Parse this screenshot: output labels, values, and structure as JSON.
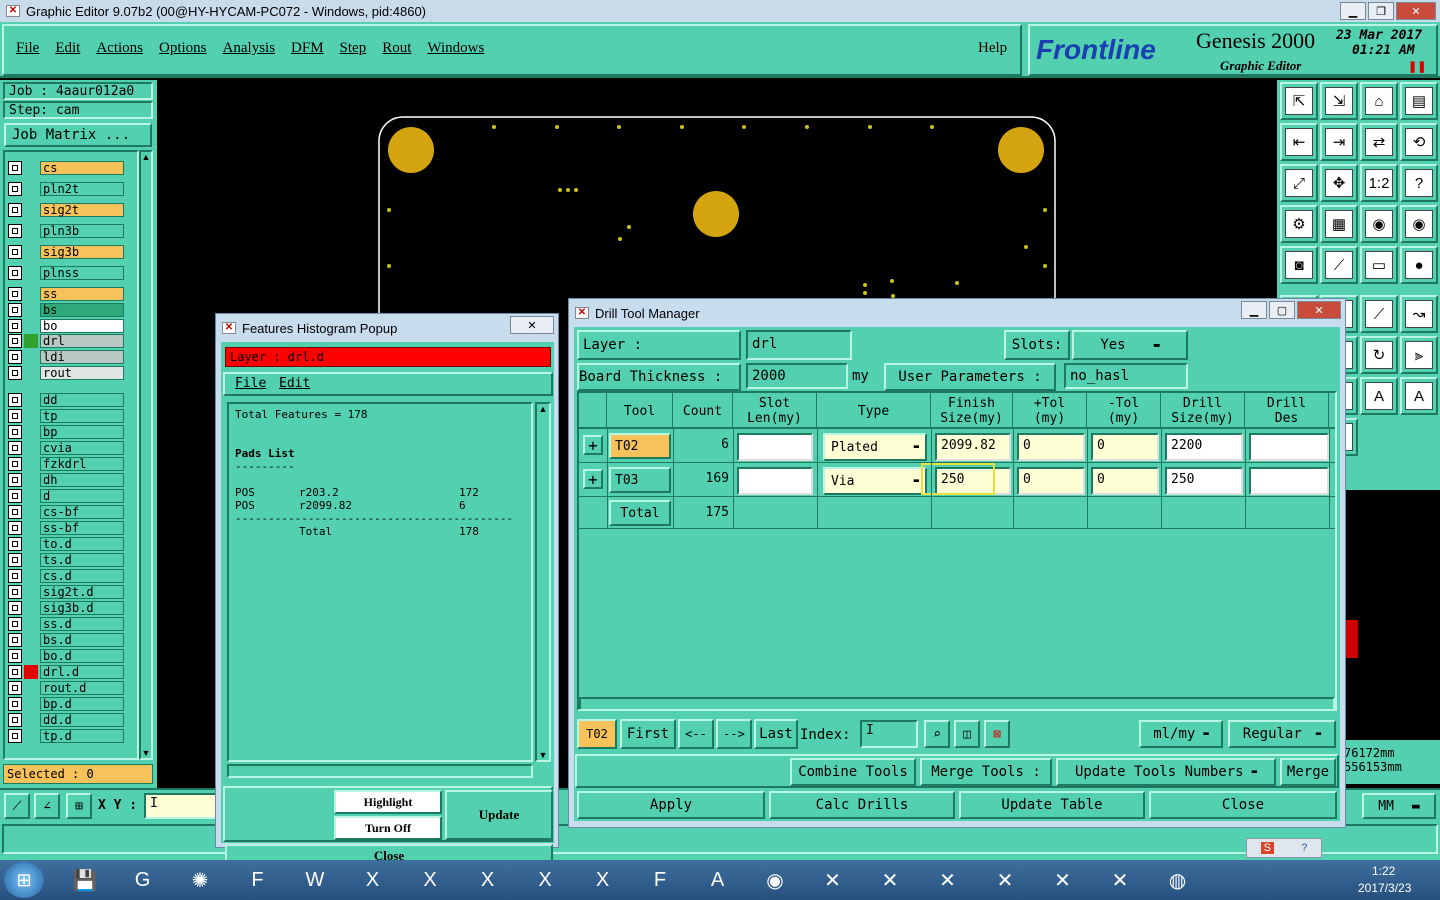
{
  "window": {
    "title": "Graphic Editor 9.07b2 (00@HY-HYCAM-PC072 - Windows, pid:4860)"
  },
  "menu": {
    "items": [
      "File",
      "Edit",
      "Actions",
      "Options",
      "Analysis",
      "DFM",
      "Step",
      "Rout",
      "Windows"
    ],
    "help": "Help"
  },
  "brand": {
    "logo": "Frontline",
    "product": "Genesis 2000",
    "subtitle": "Graphic Editor",
    "date": "23 Mar 2017",
    "time": "01:21 AM"
  },
  "job": {
    "job_label": "Job : 4aaur012a0",
    "step_label": "Step: cam",
    "matrix_button": "Job Matrix ..."
  },
  "layers": [
    {
      "name": "cs",
      "color": "#f7c25a",
      "mark": ""
    },
    {
      "name": "pln2t",
      "color": "#53d0af",
      "mark": ""
    },
    {
      "name": "sig2t",
      "color": "#f7c25a",
      "mark": ""
    },
    {
      "name": "pln3b",
      "color": "#53d0af",
      "mark": ""
    },
    {
      "name": "sig3b",
      "color": "#f7c25a",
      "mark": ""
    },
    {
      "name": "plnss",
      "color": "#53d0af",
      "mark": ""
    },
    {
      "name": "ss",
      "color": "#f7c25a",
      "mark": ""
    },
    {
      "name": "bs",
      "color": "#2eaa7a",
      "mark": ""
    },
    {
      "name": "bo",
      "color": "#ffffff",
      "mark": ""
    },
    {
      "name": "drl",
      "color": "#b9c9c2",
      "mark": "#30a030"
    },
    {
      "name": "ldi",
      "color": "#b9c9c2",
      "mark": ""
    },
    {
      "name": "rout",
      "color": "#dfe6e3",
      "mark": ""
    },
    {
      "name": "dd",
      "color": "#53d0af",
      "mark": ""
    },
    {
      "name": "tp",
      "color": "#53d0af",
      "mark": ""
    },
    {
      "name": "bp",
      "color": "#53d0af",
      "mark": ""
    },
    {
      "name": "cvia",
      "color": "#53d0af",
      "mark": ""
    },
    {
      "name": "fzkdrl",
      "color": "#53d0af",
      "mark": ""
    },
    {
      "name": "dh",
      "color": "#53d0af",
      "mark": ""
    },
    {
      "name": "d",
      "color": "#53d0af",
      "mark": ""
    },
    {
      "name": "cs-bf",
      "color": "#53d0af",
      "mark": ""
    },
    {
      "name": "ss-bf",
      "color": "#53d0af",
      "mark": ""
    },
    {
      "name": "to.d",
      "color": "#53d0af",
      "mark": ""
    },
    {
      "name": "ts.d",
      "color": "#53d0af",
      "mark": ""
    },
    {
      "name": "cs.d",
      "color": "#53d0af",
      "mark": ""
    },
    {
      "name": "sig2t.d",
      "color": "#53d0af",
      "mark": ""
    },
    {
      "name": "sig3b.d",
      "color": "#53d0af",
      "mark": ""
    },
    {
      "name": "ss.d",
      "color": "#53d0af",
      "mark": ""
    },
    {
      "name": "bs.d",
      "color": "#53d0af",
      "mark": ""
    },
    {
      "name": "bo.d",
      "color": "#53d0af",
      "mark": ""
    },
    {
      "name": "drl.d",
      "color": "#53d0af",
      "mark": "#e00000"
    },
    {
      "name": "rout.d",
      "color": "#53d0af",
      "mark": ""
    },
    {
      "name": "bp.d",
      "color": "#53d0af",
      "mark": ""
    },
    {
      "name": "dd.d",
      "color": "#53d0af",
      "mark": ""
    },
    {
      "name": "tp.d",
      "color": "#53d0af",
      "mark": ""
    }
  ],
  "selected": "Selected : 0",
  "xy_label": "X Y :",
  "histogram": {
    "title": "Features Histogram Popup",
    "layer_label": "Layer :  drl.d",
    "menu": [
      "File",
      "Edit"
    ],
    "total_line": "Total Features = 178",
    "section": "Pads List",
    "underline": "---------",
    "rows": [
      {
        "type": "POS",
        "symbol": "r203.2",
        "count": "172"
      },
      {
        "type": "POS",
        "symbol": "r2099.82",
        "count": "6"
      }
    ],
    "divider": "------------------------------------------",
    "total_label": "Total",
    "total_value": "178",
    "buttons": {
      "highlight": "Highlight",
      "turn_off": "Turn Off",
      "update": "Update",
      "close": "Close"
    }
  },
  "dtm": {
    "title": "Drill Tool Manager",
    "layer_label": "Layer        :",
    "layer_value": "drl",
    "slots_label": "Slots:",
    "slots_value": "Yes",
    "thickness_label": "Board Thickness :",
    "thickness_value": "2000",
    "thickness_unit": "my",
    "user_params_label": "User Parameters :",
    "user_params_value": "no_hasl",
    "columns": [
      "Tool",
      "Count",
      "Slot Len(my)",
      "Type",
      "Finish Size(my)",
      "+Tol (my)",
      "-Tol (my)",
      "Drill Size(my)",
      "Drill Des"
    ],
    "rows": [
      {
        "tool": "T02",
        "count": "6",
        "slot": "",
        "type": "Plated",
        "finish": "2099.82",
        "ptol": "0",
        "mtol": "0",
        "drill": "2200",
        "des": ""
      },
      {
        "tool": "T03",
        "count": "169",
        "slot": "",
        "type": "Via",
        "finish": "250",
        "ptol": "0",
        "mtol": "0",
        "drill": "250",
        "des": ""
      }
    ],
    "total_label": "Total",
    "total_count": "175",
    "nav": {
      "current": "T02",
      "first": "First",
      "prev": "<--",
      "next": "-->",
      "last": "Last",
      "index_label": "Index:",
      "units": "ml/my",
      "mode": "Regular"
    },
    "actions": {
      "combine": "Combine Tools",
      "merge_label": "Merge Tools :",
      "update_numbers": "Update Tools Numbers",
      "merge": "Merge"
    },
    "bottom": {
      "apply": "Apply",
      "calc": "Calc Drills",
      "update_table": "Update Table",
      "close": "Close"
    }
  },
  "coords": {
    "x": "76172mm",
    "y": "556153mm",
    "units": "MM"
  },
  "taskbar": {
    "time": "1:22",
    "date": "2017/3/23"
  }
}
